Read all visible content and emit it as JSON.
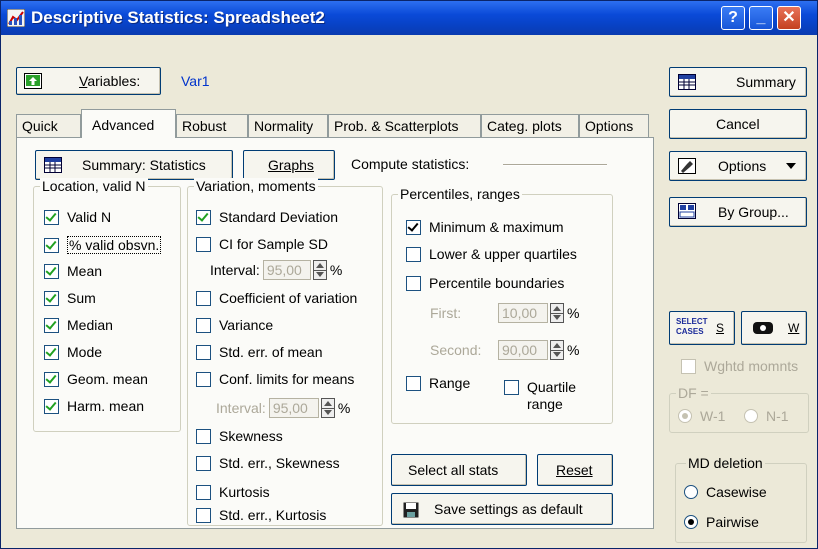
{
  "window": {
    "title": "Descriptive Statistics: Spreadsheet2"
  },
  "variables": {
    "button_label": "Variables:",
    "button_mnemonic": "V",
    "value": "Var1"
  },
  "tabs": [
    {
      "label": "Quick",
      "active": false
    },
    {
      "label": "Advanced",
      "active": true
    },
    {
      "label": "Robust",
      "active": false
    },
    {
      "label": "Normality",
      "active": false
    },
    {
      "label": "Prob. & Scatterplots",
      "active": false
    },
    {
      "label": "Categ. plots",
      "active": false
    },
    {
      "label": "Options",
      "active": false
    }
  ],
  "toolbar": {
    "summary_statistics_label": "Summary: Statistics",
    "graphs_label": "Graphs",
    "compute_statistics_label": "Compute statistics:"
  },
  "location": {
    "title": "Location, valid N",
    "items": [
      {
        "label": "Valid N",
        "checked": true
      },
      {
        "label": "% valid obsvn.",
        "checked": true
      },
      {
        "label": "Mean",
        "checked": true
      },
      {
        "label": "Sum",
        "checked": true
      },
      {
        "label": "Median",
        "checked": true
      },
      {
        "label": "Mode",
        "checked": true
      },
      {
        "label": "Geom. mean",
        "checked": true
      },
      {
        "label": "Harm. mean",
        "checked": true
      }
    ]
  },
  "variation": {
    "title": "Variation, moments",
    "std_dev": {
      "label": "Standard Deviation",
      "checked": true
    },
    "ci_sd": {
      "label": "CI for Sample SD",
      "checked": false
    },
    "interval_label": "Interval:",
    "interval_sd": "95,00",
    "percent": "%",
    "coef_var": {
      "label": "Coefficient of variation",
      "checked": false
    },
    "variance": {
      "label": "Variance",
      "checked": false
    },
    "std_err_mean": {
      "label": "Std. err. of mean",
      "checked": false
    },
    "conf_limits": {
      "label": "Conf. limits for means",
      "checked": false
    },
    "interval_means": "95,00",
    "skewness": {
      "label": "Skewness",
      "checked": false
    },
    "std_err_skew": {
      "label": "Std. err., Skewness",
      "checked": false
    },
    "kurtosis": {
      "label": "Kurtosis",
      "checked": false
    },
    "std_err_kurt": {
      "label": "Std. err., Kurtosis",
      "checked": false
    }
  },
  "percentiles": {
    "title": "Percentiles, ranges",
    "minmax": {
      "label": "Minimum & maximum",
      "checked": true
    },
    "quartiles": {
      "label": "Lower & upper quartiles",
      "checked": false
    },
    "boundaries": {
      "label": "Percentile boundaries",
      "checked": false
    },
    "first_label": "First:",
    "first_value": "10,00",
    "second_label": "Second:",
    "second_value": "90,00",
    "percent": "%",
    "range": {
      "label": "Range",
      "checked": false
    },
    "quartile_range_line1": "Quartile",
    "quartile_range_line2": "range",
    "quartile_range_checked": false
  },
  "actions": {
    "select_all_label": "Select all stats",
    "reset_label": "Reset",
    "save_default_label": "Save settings as default"
  },
  "side": {
    "summary_label": "Summary",
    "cancel_label": "Cancel",
    "options_label": "Options",
    "by_group_label": "By Group...",
    "select_cases_icon_text1": "SELECT",
    "select_cases_icon_text2": "CASES",
    "s_label": "S",
    "w_label": "W",
    "wghtd_label": "Wghtd momnts",
    "df_title": "DF =",
    "df_w1": "W-1",
    "df_n1": "N-1",
    "md_title": "MD deletion",
    "casewise": "Casewise",
    "pairwise": "Pairwise"
  },
  "colors": {
    "title_bar": "#0a4ad8",
    "checkmark": "#21a121",
    "dialog_bg": "#ece9d8"
  }
}
